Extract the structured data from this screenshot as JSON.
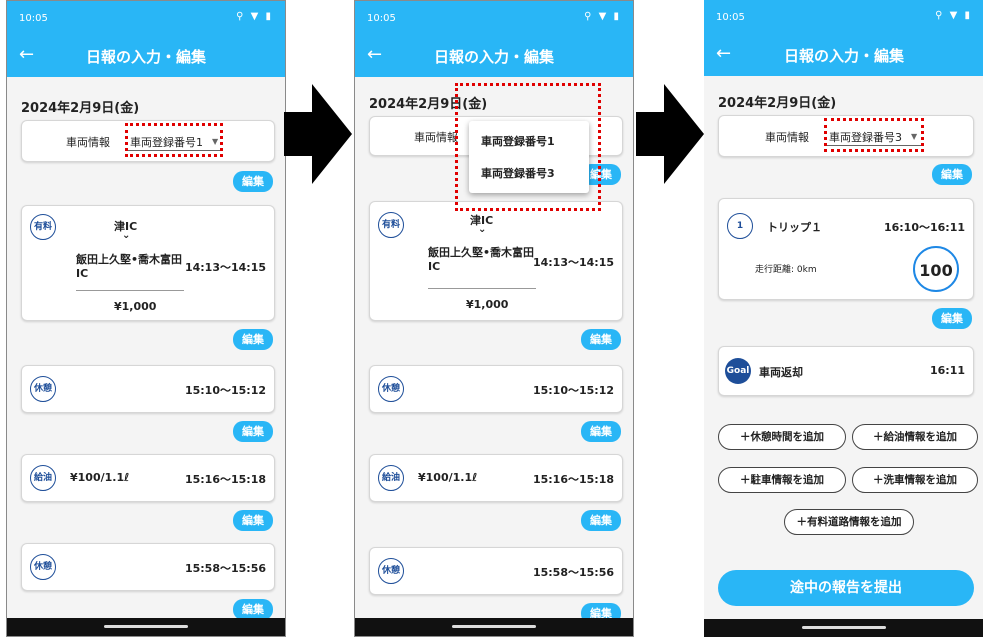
{
  "status": {
    "time": "10:05",
    "icons": "⚲ ▼ ▮"
  },
  "app": {
    "title": "日報の入力・編集",
    "back": "←"
  },
  "date": "2024年2月9日(金)",
  "vehicle_label": "車両情報",
  "vehicle_options": [
    "車両登録番号1",
    "車両登録番号3"
  ],
  "edit_label": "編集",
  "caret": "▼",
  "chevron": "⌄",
  "toll": {
    "badge": "有料",
    "from": "津IC",
    "to_line1": "飯田上久堅•喬木富田",
    "to_line2": "IC",
    "time": "14:13〜14:15",
    "amount": "¥1,000"
  },
  "rest1": {
    "badge": "休憩",
    "time": "15:10〜15:12"
  },
  "fuel": {
    "badge": "給油",
    "text": "¥100/1.1ℓ",
    "time": "15:16〜15:18"
  },
  "rest2": {
    "badge": "休憩",
    "time": "15:58〜15:56"
  },
  "trip": {
    "number": "1",
    "label": "トリップ１",
    "time": "16:10〜16:11",
    "distance": "走行距離: 0km",
    "score": "100"
  },
  "goal": {
    "badge": "Goal",
    "label": "車両返却",
    "time": "16:11"
  },
  "add_buttons": [
    "＋休憩時間を追加",
    "＋給油情報を追加",
    "＋駐車情報を追加",
    "＋洗車情報を追加",
    "＋有料道路情報を追加"
  ],
  "submit_label": "途中の報告を提出",
  "colors": {
    "accent": "#29b6f6",
    "navy": "#1e4e99",
    "highlight": "#e00000"
  }
}
